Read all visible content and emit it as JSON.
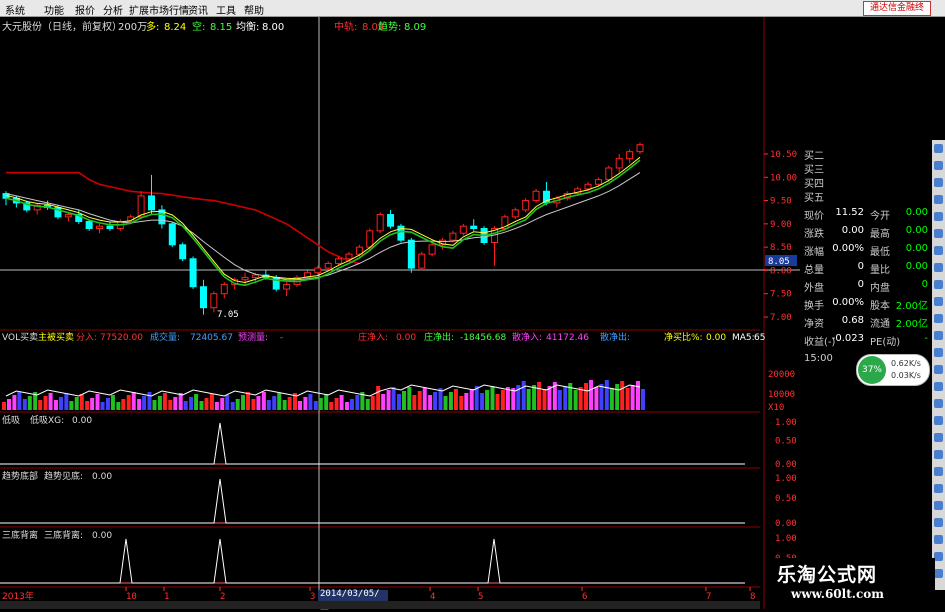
{
  "menu": {
    "items": [
      "系统",
      "功能",
      "报价",
      "分析",
      "扩展市场行情",
      "资讯",
      "工具",
      "帮助"
    ],
    "ad": "通达信金融终"
  },
  "main_header": {
    "stock": "大元股份（日线，前复权）",
    "vol_label": "200万",
    "duo_label": "多:",
    "duo_val": "8.24",
    "kong_label": "空:",
    "kong_val": "8.15",
    "junheng_label": "均衡:",
    "junheng_val": "8.00",
    "zhongshu_label": "中轨:",
    "zhongshu_val": "8.09",
    "qushi_label": "趋势:",
    "qushi_val": "8.09"
  },
  "price_axis": [
    "10.50",
    "10.00",
    "9.50",
    "9.00",
    "8.50",
    "8.00",
    "7.50",
    "7.00"
  ],
  "price_marker": "8.05",
  "low_label": "7.05",
  "vol_header": {
    "title": "VOL买卖",
    "zhuli_label": "主被买卖",
    "fen_label": "分入:",
    "fen_val": "77520.00",
    "cheng_label": "成交量:",
    "cheng_val": "72405.67",
    "yuce_label": "预测量:",
    "yuce_val": "-",
    "zhujing_label": "庄净入:",
    "zhujing_val": "0.00",
    "zhuangchu_label": "庄净出:",
    "zhuangchu_val": "-18456.68",
    "sanjing_label": "散净入:",
    "sanjing_val": "41172.46",
    "sanchu_label": "散净出:",
    "sanchu_val": "",
    "jingmai_label": "净买比%:",
    "jingmai_val": "0.00",
    "ma5_label": "MA5:",
    "ma5_val": "65"
  },
  "vol_axis": [
    "20000",
    "10000",
    "X10"
  ],
  "panel1": {
    "title": "低吸",
    "sub": "低吸XG:",
    "val": "0.00",
    "axis": [
      "1.00",
      "0.50",
      "0.00"
    ]
  },
  "panel2": {
    "title": "趋势底部",
    "sub": "趋势见底:",
    "val": "0.00",
    "axis": [
      "1.00",
      "0.50",
      "0.00"
    ]
  },
  "panel3": {
    "title": "三底背离",
    "sub": "三底背离:",
    "val": "0.00",
    "axis": [
      "1.00",
      "0.50",
      "0.00"
    ]
  },
  "time_axis": {
    "year": "2013年",
    "ticks": [
      "10",
      "1",
      "2",
      "3",
      "4",
      "5",
      "6",
      "7",
      "8"
    ],
    "cursor_date": "2014/03/05/三"
  },
  "quote": {
    "bids": [
      "买二",
      "买三",
      "买四",
      "买五"
    ],
    "rows": [
      {
        "l": "现价",
        "v": "11.52",
        "l2": "今开",
        "v2": "0.00"
      },
      {
        "l": "涨跌",
        "v": "0.00",
        "l2": "最高",
        "v2": "0.00"
      },
      {
        "l": "涨幅",
        "v": "0.00%",
        "l2": "最低",
        "v2": "0.00"
      },
      {
        "l": "总量",
        "v": "0",
        "l2": "量比",
        "v2": "0.00"
      },
      {
        "l": "外盘",
        "v": "0",
        "l2": "内盘",
        "v2": "0"
      },
      {
        "l": "换手",
        "v": "0.00%",
        "l2": "股本",
        "v2": "2.00亿"
      },
      {
        "l": "净资",
        "v": "0.68",
        "l2": "流通",
        "v2": "2.00亿"
      },
      {
        "l": "收益(-)",
        "v": "-0.023",
        "l2": "PE(动)",
        "v2": "-"
      }
    ],
    "time": "15:00"
  },
  "gauge": {
    "pct": "37%",
    "up": "0.62K/s",
    "down": "0.03K/s"
  },
  "watermark": {
    "title": "乐淘公式网",
    "url": "www.60lt.com"
  },
  "colors": {
    "up": "#ff2020",
    "down": "#00ffff",
    "ma_red": "#cc0000",
    "ma_green": "#20c020"
  },
  "chart_data": {
    "type": "line",
    "candles": [
      [
        9.65,
        9.7,
        9.4,
        9.55
      ],
      [
        9.55,
        9.6,
        9.35,
        9.45
      ],
      [
        9.45,
        9.5,
        9.25,
        9.3
      ],
      [
        9.3,
        9.45,
        9.2,
        9.4
      ],
      [
        9.4,
        9.5,
        9.3,
        9.35
      ],
      [
        9.35,
        9.4,
        9.1,
        9.15
      ],
      [
        9.15,
        9.25,
        9.05,
        9.2
      ],
      [
        9.2,
        9.3,
        9.0,
        9.05
      ],
      [
        9.05,
        9.1,
        8.85,
        8.9
      ],
      [
        8.9,
        9.0,
        8.8,
        8.95
      ],
      [
        8.95,
        9.05,
        8.85,
        8.9
      ],
      [
        8.9,
        9.1,
        8.85,
        9.05
      ],
      [
        9.05,
        9.2,
        9.0,
        9.15
      ],
      [
        9.15,
        9.7,
        9.1,
        9.6
      ],
      [
        9.6,
        10.05,
        9.2,
        9.3
      ],
      [
        9.3,
        9.4,
        8.9,
        9.0
      ],
      [
        9.0,
        9.05,
        8.5,
        8.55
      ],
      [
        8.55,
        8.6,
        8.2,
        8.25
      ],
      [
        8.25,
        8.3,
        7.6,
        7.65
      ],
      [
        7.65,
        7.8,
        7.05,
        7.2
      ],
      [
        7.2,
        7.55,
        7.1,
        7.5
      ],
      [
        7.5,
        7.75,
        7.4,
        7.7
      ],
      [
        7.7,
        7.85,
        7.6,
        7.8
      ],
      [
        7.8,
        7.95,
        7.7,
        7.85
      ],
      [
        7.85,
        7.95,
        7.75,
        7.9
      ],
      [
        7.9,
        8.0,
        7.8,
        7.85
      ],
      [
        7.85,
        7.9,
        7.55,
        7.6
      ],
      [
        7.6,
        7.75,
        7.45,
        7.7
      ],
      [
        7.7,
        7.9,
        7.65,
        7.85
      ],
      [
        7.85,
        8.0,
        7.8,
        7.95
      ],
      [
        7.95,
        8.1,
        7.9,
        8.05
      ],
      [
        8.05,
        8.2,
        8.0,
        8.15
      ],
      [
        8.15,
        8.3,
        8.1,
        8.25
      ],
      [
        8.25,
        8.4,
        8.2,
        8.35
      ],
      [
        8.35,
        8.55,
        8.3,
        8.5
      ],
      [
        8.5,
        8.9,
        8.45,
        8.85
      ],
      [
        8.85,
        9.25,
        8.8,
        9.2
      ],
      [
        9.2,
        9.3,
        8.9,
        8.95
      ],
      [
        8.95,
        9.0,
        8.6,
        8.65
      ],
      [
        8.65,
        8.7,
        7.95,
        8.05
      ],
      [
        8.05,
        8.4,
        8.0,
        8.35
      ],
      [
        8.35,
        8.6,
        8.3,
        8.55
      ],
      [
        8.55,
        8.7,
        8.45,
        8.65
      ],
      [
        8.65,
        8.85,
        8.6,
        8.8
      ],
      [
        8.8,
        9.0,
        8.75,
        8.95
      ],
      [
        8.95,
        9.1,
        8.85,
        8.9
      ],
      [
        8.9,
        8.95,
        8.55,
        8.6
      ],
      [
        8.6,
        8.95,
        8.1,
        8.9
      ],
      [
        8.9,
        9.2,
        8.85,
        9.15
      ],
      [
        9.15,
        9.35,
        9.1,
        9.3
      ],
      [
        9.3,
        9.55,
        9.25,
        9.5
      ],
      [
        9.5,
        9.75,
        9.45,
        9.7
      ],
      [
        9.7,
        9.9,
        9.4,
        9.45
      ],
      [
        9.45,
        9.6,
        9.35,
        9.55
      ],
      [
        9.55,
        9.7,
        9.5,
        9.65
      ],
      [
        9.65,
        9.8,
        9.6,
        9.75
      ],
      [
        9.75,
        9.9,
        9.7,
        9.85
      ],
      [
        9.85,
        10.0,
        9.8,
        9.95
      ],
      [
        9.95,
        10.25,
        9.9,
        10.2
      ],
      [
        10.2,
        10.5,
        10.1,
        10.4
      ],
      [
        10.4,
        10.6,
        10.3,
        10.55
      ],
      [
        10.55,
        10.75,
        10.5,
        10.7
      ]
    ],
    "ma_fast": [
      9.55,
      9.5,
      9.42,
      9.38,
      9.36,
      9.3,
      9.24,
      9.18,
      9.08,
      9.02,
      8.98,
      8.98,
      9.01,
      9.13,
      9.2,
      9.21,
      9.13,
      8.95,
      8.69,
      8.41,
      8.13,
      7.86,
      7.72,
      7.68,
      7.75,
      7.83,
      7.79,
      7.77,
      7.76,
      7.8,
      7.83,
      7.93,
      8.05,
      8.15,
      8.27,
      8.43,
      8.63,
      8.77,
      8.84,
      8.82,
      8.71,
      8.6,
      8.51,
      8.48,
      8.66,
      8.77,
      8.75,
      8.8,
      8.88,
      8.99,
      9.09,
      9.31,
      9.44,
      9.5,
      9.57,
      9.62,
      9.67,
      9.75,
      9.87,
      10.02,
      10.19,
      10.37
    ],
    "ma_mid": [
      9.65,
      9.6,
      9.55,
      9.5,
      9.45,
      9.4,
      9.35,
      9.3,
      9.22,
      9.15,
      9.08,
      9.04,
      9.02,
      9.05,
      9.08,
      9.08,
      9.04,
      8.95,
      8.8,
      8.62,
      8.45,
      8.28,
      8.12,
      8.0,
      7.92,
      7.88,
      7.84,
      7.8,
      7.8,
      7.82,
      7.85,
      7.9,
      7.98,
      8.06,
      8.15,
      8.26,
      8.39,
      8.5,
      8.58,
      8.62,
      8.63,
      8.63,
      8.62,
      8.63,
      8.66,
      8.7,
      8.72,
      8.76,
      8.82,
      8.9,
      8.99,
      9.1,
      9.2,
      9.28,
      9.36,
      9.44,
      9.52,
      9.6,
      9.7,
      9.82,
      9.96,
      10.1
    ],
    "ma_red": [
      10.1,
      10.1,
      10.1,
      10.1,
      10.1,
      10.1,
      10.1,
      10.1,
      9.95,
      9.85,
      9.8,
      9.75,
      9.7,
      9.68,
      9.66,
      9.65,
      9.62,
      9.58,
      9.55,
      9.52,
      9.5,
      9.45,
      9.4,
      9.35,
      9.3,
      9.2,
      9.1,
      9.0,
      8.85,
      8.7,
      8.55,
      8.4,
      8.3,
      8.2,
      8.15
    ]
  }
}
